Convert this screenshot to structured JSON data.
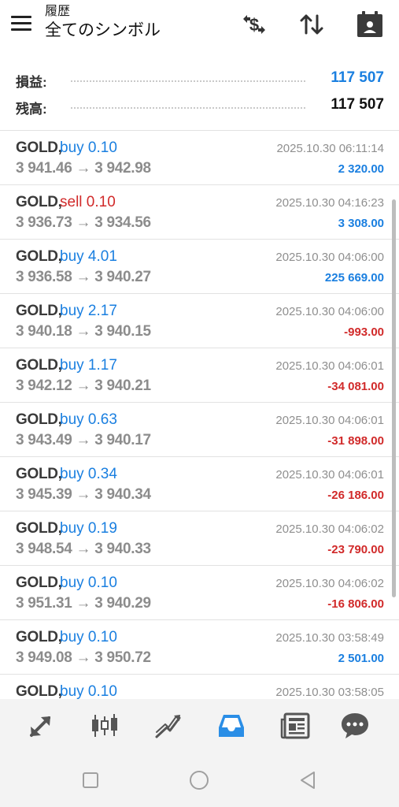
{
  "header": {
    "subtitle": "履歴",
    "title": "全てのシンボル",
    "icons": [
      "menu-icon",
      "currency-exchange-icon",
      "sort-icon",
      "calendar-icon"
    ]
  },
  "summary": {
    "profit_label": "損益:",
    "profit_value": "117 507",
    "balance_label": "残高:",
    "balance_value": "117 507"
  },
  "colors": {
    "buy": "#1a7fe0",
    "sell": "#d12a2a",
    "profit_positive": "#1a7fe0",
    "profit_negative": "#d12a2a",
    "accent": "#2a8ee6"
  },
  "trades": [
    {
      "symbol": "GOLD,",
      "side": "buy 0.10",
      "prices": "3 941.46 → 3 942.98",
      "time": "2025.10.30 06:11:14",
      "profit": "2 320.00"
    },
    {
      "symbol": "GOLD,",
      "side": "sell 0.10",
      "prices": "3 936.73 → 3 934.56",
      "time": "2025.10.30 04:16:23",
      "profit": "3 308.00"
    },
    {
      "symbol": "GOLD,",
      "side": "buy 4.01",
      "prices": "3 936.58 → 3 940.27",
      "time": "2025.10.30 04:06:00",
      "profit": "225 669.00"
    },
    {
      "symbol": "GOLD,",
      "side": "buy 2.17",
      "prices": "3 940.18 → 3 940.15",
      "time": "2025.10.30 04:06:00",
      "profit": "-993.00"
    },
    {
      "symbol": "GOLD,",
      "side": "buy 1.17",
      "prices": "3 942.12 → 3 940.21",
      "time": "2025.10.30 04:06:01",
      "profit": "-34 081.00"
    },
    {
      "symbol": "GOLD,",
      "side": "buy 0.63",
      "prices": "3 943.49 → 3 940.17",
      "time": "2025.10.30 04:06:01",
      "profit": "-31 898.00"
    },
    {
      "symbol": "GOLD,",
      "side": "buy 0.34",
      "prices": "3 945.39 → 3 940.34",
      "time": "2025.10.30 04:06:01",
      "profit": "-26 186.00"
    },
    {
      "symbol": "GOLD,",
      "side": "buy 0.19",
      "prices": "3 948.54 → 3 940.33",
      "time": "2025.10.30 04:06:02",
      "profit": "-23 790.00"
    },
    {
      "symbol": "GOLD,",
      "side": "buy 0.10",
      "prices": "3 951.31 → 3 940.29",
      "time": "2025.10.30 04:06:02",
      "profit": "-16 806.00"
    },
    {
      "symbol": "GOLD,",
      "side": "buy 0.10",
      "prices": "3 949.08 → 3 950.72",
      "time": "2025.10.30 03:58:49",
      "profit": "2 501.00"
    },
    {
      "symbol": "GOLD,",
      "side": "buy 0.10",
      "prices": "",
      "time": "2025.10.30 03:58:05",
      "profit": ""
    }
  ],
  "tabs": [
    {
      "name": "quotes-tab",
      "icon": "quotes-arrows-icon",
      "active": false
    },
    {
      "name": "chart-tab",
      "icon": "candlestick-icon",
      "active": false
    },
    {
      "name": "trade-tab",
      "icon": "trade-trend-icon",
      "active": false
    },
    {
      "name": "history-tab",
      "icon": "inbox-icon",
      "active": true
    },
    {
      "name": "news-tab",
      "icon": "newspaper-icon",
      "active": false
    },
    {
      "name": "messages-tab",
      "icon": "chat-bubble-icon",
      "active": false
    }
  ],
  "system_nav": [
    "recent-apps-icon",
    "home-icon",
    "back-icon"
  ]
}
